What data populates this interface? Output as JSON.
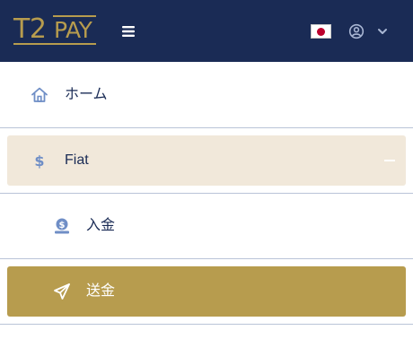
{
  "header": {
    "logo": {
      "brand_main": "T2",
      "brand_sub": "PAY"
    },
    "menu_toggle_icon": "hamburger-icon",
    "language_flag": "japan-flag",
    "user_icon": "user-circle-icon",
    "dropdown_icon": "chevron-down-icon"
  },
  "nav": {
    "items": [
      {
        "label": "ホーム",
        "icon": "home-icon"
      },
      {
        "label": "Fiat",
        "icon": "dollar-icon",
        "expanded": true
      },
      {
        "label": "入金",
        "icon": "deposit-icon"
      },
      {
        "label": "送金",
        "icon": "send-icon",
        "active": true
      }
    ]
  },
  "colors": {
    "header_bg": "#1a2b55",
    "brand_gold": "#b79c4e",
    "active_bg": "#b79c4e",
    "expanded_bg": "#f1e8da",
    "text": "#1a2b55",
    "icon": "#6f8ec6",
    "divider": "#b9c4d8"
  }
}
